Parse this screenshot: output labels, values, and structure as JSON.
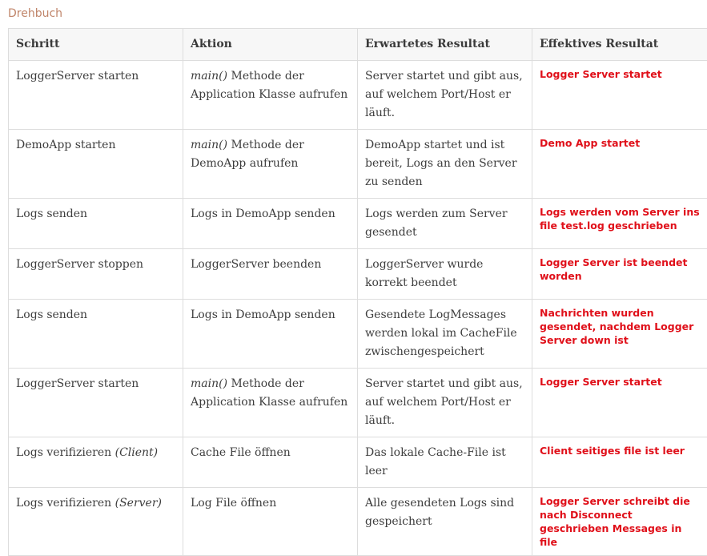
{
  "page": {
    "title": "Drehbuch"
  },
  "table": {
    "headers": [
      "Schritt",
      "Aktion",
      "Erwartetes Resultat",
      "Effektives Resultat"
    ],
    "rows": [
      {
        "schritt": "LoggerServer starten",
        "schritt_em": "",
        "aktion_em": "main()",
        "aktion": " Methode der Application Klasse aufrufen",
        "erwartet": "Server startet und gibt aus, auf welchem Port/Host er läuft.",
        "effektiv": "Logger Server startet"
      },
      {
        "schritt": "DemoApp starten",
        "schritt_em": "",
        "aktion_em": "main()",
        "aktion": " Methode der DemoApp aufrufen",
        "erwartet": "DemoApp startet und ist bereit, Logs an den Server zu senden",
        "effektiv": "Demo App startet"
      },
      {
        "schritt": "Logs senden",
        "schritt_em": "",
        "aktion_em": "",
        "aktion": "Logs in DemoApp senden",
        "erwartet": "Logs werden zum Server gesendet",
        "effektiv": "Logs werden vom Server ins file test.log geschrieben"
      },
      {
        "schritt": "LoggerServer stoppen",
        "schritt_em": "",
        "aktion_em": "",
        "aktion": "LoggerServer beenden",
        "erwartet": "LoggerServer wurde korrekt beendet",
        "effektiv": "Logger Server ist beendet worden"
      },
      {
        "schritt": "Logs senden",
        "schritt_em": "",
        "aktion_em": "",
        "aktion": "Logs in DemoApp senden",
        "erwartet": "Gesendete LogMessages werden lokal im CacheFile zwischengespeichert",
        "effektiv": "Nachrichten wurden gesendet, nachdem Logger Server down ist"
      },
      {
        "schritt": "LoggerServer starten",
        "schritt_em": "",
        "aktion_em": "main()",
        "aktion": " Methode der Application Klasse aufrufen",
        "erwartet": "Server startet und gibt aus, auf welchem Port/Host er läuft.",
        "effektiv": "Logger Server startet"
      },
      {
        "schritt": "Logs verifizieren ",
        "schritt_em": "(Client)",
        "aktion_em": "",
        "aktion": "Cache File öffnen",
        "erwartet": "Das lokale Cache-File ist leer",
        "effektiv": "Client seitiges file ist leer"
      },
      {
        "schritt": "Logs verifizieren ",
        "schritt_em": "(Server)",
        "aktion_em": "",
        "aktion": "Log File öffnen",
        "erwartet": "Alle gesendeten Logs sind gespeichert",
        "effektiv": "Logger Server schreibt die nach Disconnect geschrieben Messages in file"
      }
    ]
  }
}
